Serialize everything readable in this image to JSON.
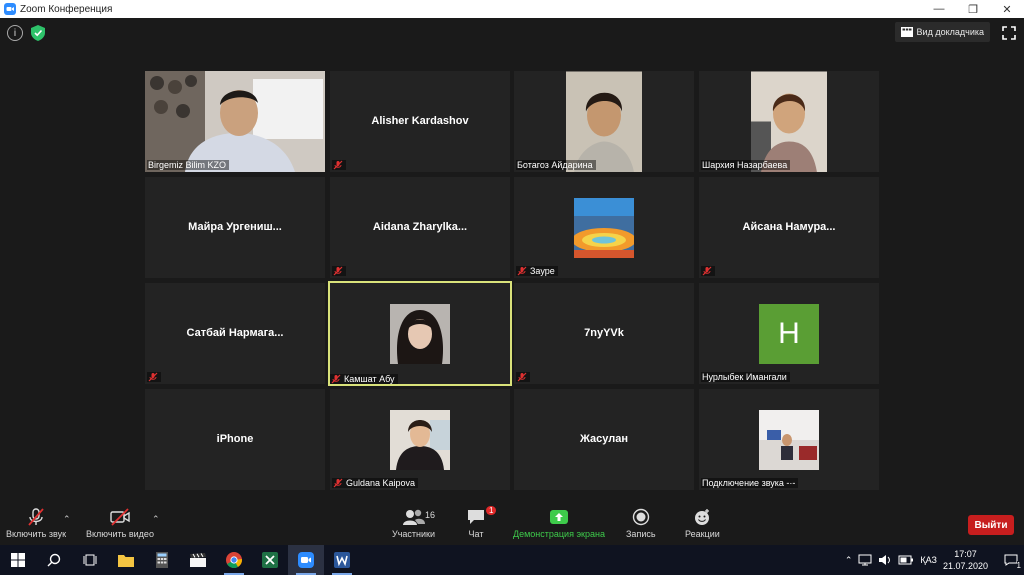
{
  "window": {
    "title": "Zoom Конференция",
    "minimize": "—",
    "restore": "❐",
    "close": "✕"
  },
  "topbar": {
    "view_label": "Вид докладчика"
  },
  "tiles": [
    {
      "name": "Birgemiz Bilim KZO",
      "type": "video",
      "muted": false
    },
    {
      "name": "Alisher Kardashov",
      "type": "name",
      "muted": true
    },
    {
      "name": "Ботагоз Айдарина",
      "type": "video",
      "muted": false
    },
    {
      "name": "Шархия Назарбаева",
      "type": "video",
      "muted": false
    },
    {
      "name": "Майра Ургениш...",
      "type": "name",
      "muted": false
    },
    {
      "name": "Aidana Zharylka...",
      "type": "name",
      "muted": true
    },
    {
      "name": "Зауре",
      "type": "photo",
      "muted": true
    },
    {
      "name": "Айсана Намура...",
      "type": "name",
      "muted": true
    },
    {
      "name": "Сатбай Нармага...",
      "type": "name",
      "muted": true
    },
    {
      "name": "Камшат Абу",
      "type": "photo",
      "muted": true,
      "active": true
    },
    {
      "name": "7nyYVk",
      "type": "name",
      "muted": true
    },
    {
      "name": "Нурлыбек Имангали",
      "type": "initial",
      "initial": "H",
      "muted": false
    },
    {
      "name": "iPhone",
      "type": "name",
      "muted": false
    },
    {
      "name": "Guldana Kaipova",
      "type": "photo",
      "muted": true
    },
    {
      "name": "Жасулан",
      "type": "name",
      "muted": false
    },
    {
      "name": "Подключение звука -·-",
      "type": "photo",
      "muted": false
    }
  ],
  "toolbar": {
    "audio_label": "Включить звук",
    "video_label": "Включить видео",
    "participants_label": "Участники",
    "participants_count": "16",
    "chat_label": "Чат",
    "chat_badge": "1",
    "share_label": "Демонстрация экрана",
    "record_label": "Запись",
    "reactions_label": "Реакции",
    "leave_label": "Выйти"
  },
  "taskbar": {
    "lang": "ҚАЗ",
    "time": "17:07",
    "date": "21.07.2020",
    "notif": "1"
  },
  "colors": {
    "accent_green": "#3ecb4b",
    "leave_red": "#c71e1e",
    "active_border": "#d9e27a",
    "initial_bg": "#5a9e34"
  }
}
